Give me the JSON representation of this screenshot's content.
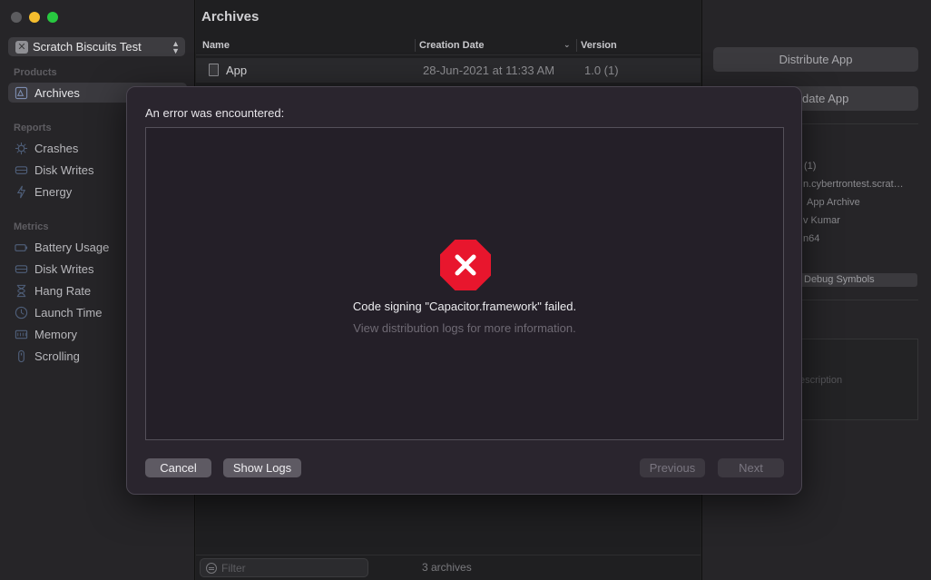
{
  "window": {
    "title": "Archives"
  },
  "sidebar": {
    "scheme": "Scratch Biscuits Test",
    "sections": {
      "products": "Products",
      "reports": "Reports",
      "metrics": "Metrics"
    },
    "products_items": [
      {
        "label": "Archives",
        "icon": "archive-icon",
        "selected": true
      }
    ],
    "reports_items": [
      {
        "label": "Crashes",
        "icon": "crash-icon"
      },
      {
        "label": "Disk Writes",
        "icon": "disk-icon"
      },
      {
        "label": "Energy",
        "icon": "bolt-icon"
      }
    ],
    "metrics_items": [
      {
        "label": "Battery Usage",
        "icon": "battery-icon"
      },
      {
        "label": "Disk Writes",
        "icon": "disk-icon"
      },
      {
        "label": "Hang Rate",
        "icon": "hourglass-icon"
      },
      {
        "label": "Launch Time",
        "icon": "clock-icon"
      },
      {
        "label": "Memory",
        "icon": "memory-icon"
      },
      {
        "label": "Scrolling",
        "icon": "scroll-icon"
      }
    ]
  },
  "list": {
    "columns": {
      "name": "Name",
      "date": "Creation Date",
      "version": "Version"
    },
    "rows": [
      {
        "name": "App",
        "date": "28-Jun-2021 at 11:33 AM",
        "version": "1.0 (1)"
      }
    ],
    "filter_placeholder": "Filter",
    "count": "3 archives"
  },
  "inspector": {
    "distribute_label": "Distribute App",
    "validate_label": "date App",
    "fragments": {
      "version": "(1)",
      "identifier": "n.cybertrontest.scrat…",
      "type": "App Archive",
      "team": "v Kumar",
      "arch": "n64",
      "description_placeholder": "escription"
    },
    "debug_symbols_label": "Debug Symbols"
  },
  "dialog": {
    "title": "An error was encountered:",
    "message": "Code signing \"Capacitor.framework\" failed.",
    "submessage": "View distribution logs for more information.",
    "icon": "error-octagon-icon",
    "error_color": "#e8162d",
    "buttons": {
      "cancel": "Cancel",
      "show_logs": "Show Logs",
      "previous": "Previous",
      "next": "Next"
    }
  }
}
